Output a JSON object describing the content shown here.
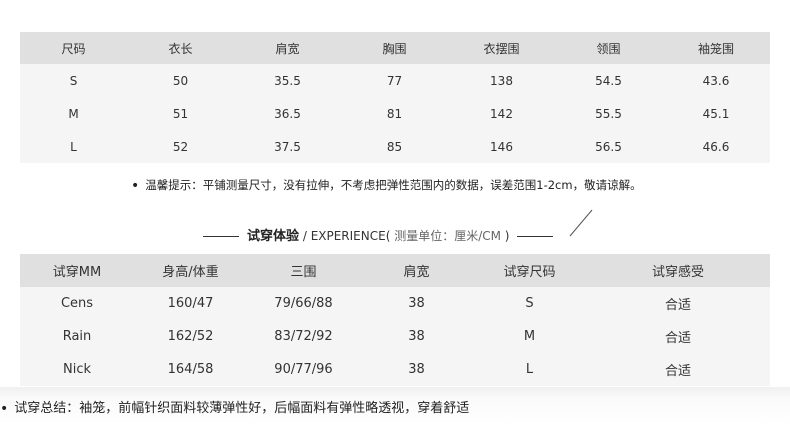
{
  "size_table": {
    "headers": [
      "尺码",
      "衣长",
      "肩宽",
      "胸围",
      "衣摆围",
      "领围",
      "袖笼围"
    ],
    "rows": [
      [
        "S",
        "50",
        "35.5",
        "77",
        "138",
        "54.5",
        "43.6"
      ],
      [
        "M",
        "51",
        "36.5",
        "81",
        "142",
        "55.5",
        "45.1"
      ],
      [
        "L",
        "52",
        "37.5",
        "85",
        "146",
        "56.5",
        "46.6"
      ]
    ]
  },
  "note": "温馨提示：平铺测量尺寸，没有拉伸，不考虑把弹性范围内的数据，误差范围1-2cm，敬请谅解。",
  "experience": {
    "title_zh": "试穿体验",
    "title_en": " / EXPERIENCE(",
    "title_unit": " 测量单位：厘米/CM ",
    "title_close": ")",
    "headers": [
      "试穿MM",
      "身高/体重",
      "三围",
      "肩宽",
      "试穿尺码",
      "试穿感受"
    ],
    "rows": [
      [
        "Cens",
        "160/47",
        "79/66/88",
        "38",
        "S",
        "合适"
      ],
      [
        "Rain",
        "162/52",
        "83/72/92",
        "38",
        "M",
        "合适"
      ],
      [
        "Nick",
        "164/58",
        "90/77/96",
        "38",
        "L",
        "合适"
      ]
    ]
  },
  "summary": "试穿总结：袖笼，前幅针织面料较薄弹性好，后幅面料有弹性略透视，穿着舒适"
}
